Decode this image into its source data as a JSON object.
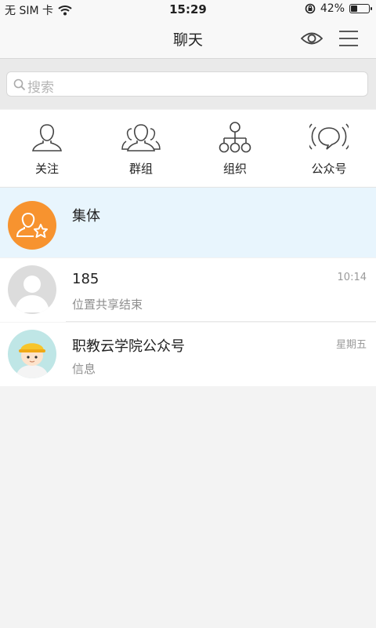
{
  "status_bar": {
    "carrier": "无 SIM 卡",
    "time": "15:29",
    "battery": "42%",
    "battery_level": 0.42
  },
  "nav": {
    "title": "聊天"
  },
  "search": {
    "placeholder": "搜索"
  },
  "quick": {
    "items": [
      {
        "label": "关注",
        "icon": "person-icon"
      },
      {
        "label": "群组",
        "icon": "group-icon"
      },
      {
        "label": "组织",
        "icon": "org-chart-icon"
      },
      {
        "label": "公众号",
        "icon": "broadcast-icon"
      }
    ]
  },
  "chats": [
    {
      "name": "集体",
      "preview": "",
      "time": "",
      "avatar": "group-star-avatar",
      "selected": true
    },
    {
      "name": "185",
      "preview": "位置共享结束",
      "time": "10:14",
      "avatar": "default-avatar"
    },
    {
      "name": "职教云学院公众号",
      "preview": "信息",
      "time": "星期五",
      "avatar": "worker-avatar"
    }
  ],
  "colors": {
    "accent_orange": "#f7932f",
    "selected_row": "#e8f5fd"
  }
}
